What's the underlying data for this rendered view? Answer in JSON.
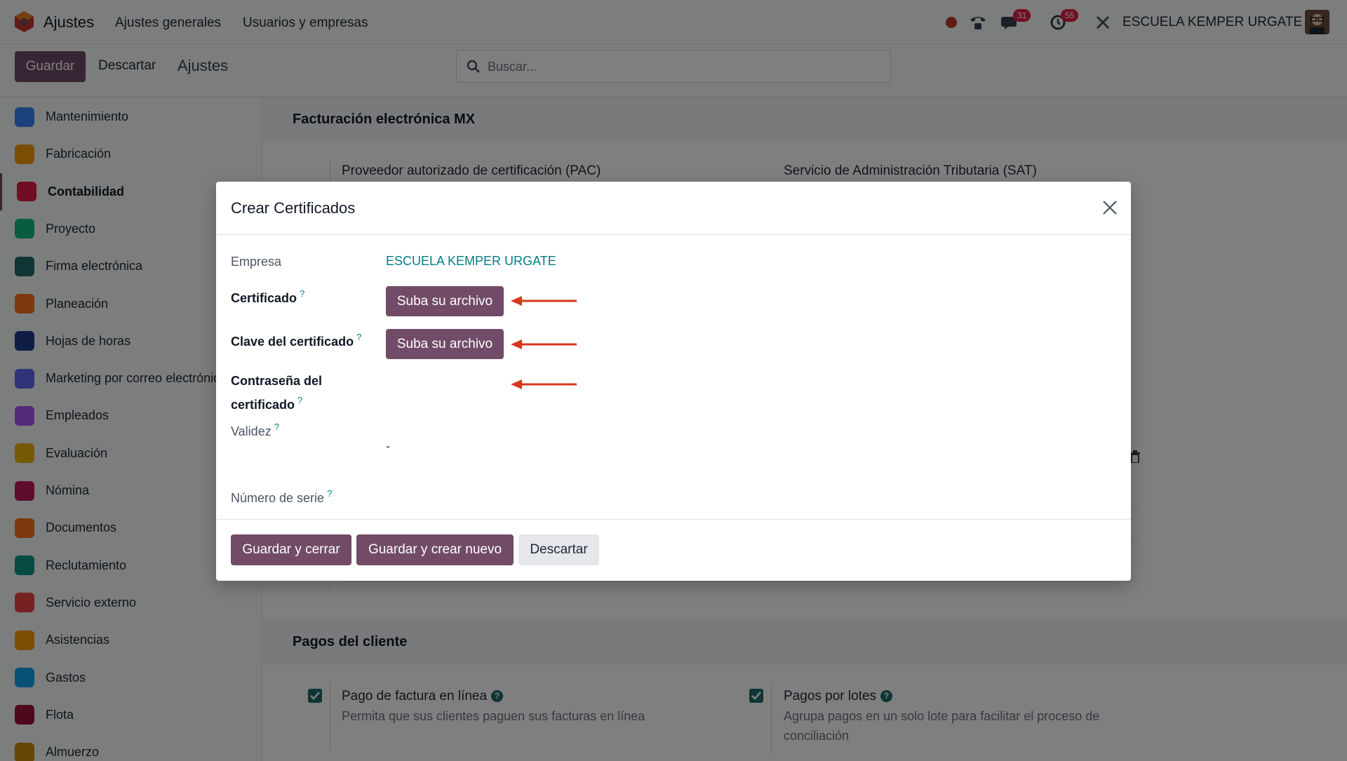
{
  "navbar": {
    "app_name": "Ajustes",
    "menu": [
      "Ajustes generales",
      "Usuarios y empresas"
    ],
    "chat_count": "31",
    "activity_count": "55",
    "company": "ESCUELA KEMPER URGATE"
  },
  "control_panel": {
    "save_label": "Guardar",
    "discard_label": "Descartar",
    "title": "Ajustes",
    "search_placeholder": "Buscar..."
  },
  "sidebar": {
    "items": [
      {
        "label": "Mantenimiento",
        "icon": "maintenance-icon",
        "color": "#3b82f6"
      },
      {
        "label": "Fabricación",
        "icon": "manufacturing-icon",
        "color": "#f59e0b"
      },
      {
        "label": "Contabilidad",
        "icon": "accounting-icon",
        "color": "#e11d48",
        "active": true
      },
      {
        "label": "Proyecto",
        "icon": "project-icon",
        "color": "#10b981"
      },
      {
        "label": "Firma electrónica",
        "icon": "signature-icon",
        "color": "#1e6a6b"
      },
      {
        "label": "Planeación",
        "icon": "planning-icon",
        "color": "#f97316"
      },
      {
        "label": "Hojas de horas",
        "icon": "timesheet-icon",
        "color": "#1e3a8a"
      },
      {
        "label": "Marketing por correo electrónico",
        "icon": "email-marketing-icon",
        "color": "#6366f1"
      },
      {
        "label": "Empleados",
        "icon": "employees-icon",
        "color": "#a855f7"
      },
      {
        "label": "Evaluación",
        "icon": "appraisal-icon",
        "color": "#eab308"
      },
      {
        "label": "Nómina",
        "icon": "payroll-icon",
        "color": "#be185d"
      },
      {
        "label": "Documentos",
        "icon": "documents-icon",
        "color": "#f97316"
      },
      {
        "label": "Reclutamiento",
        "icon": "recruitment-icon",
        "color": "#0d9488"
      },
      {
        "label": "Servicio externo",
        "icon": "field-service-icon",
        "color": "#ef4444"
      },
      {
        "label": "Asistencias",
        "icon": "attendances-icon",
        "color": "#f59e0b"
      },
      {
        "label": "Gastos",
        "icon": "expenses-icon",
        "color": "#0ea5e9"
      },
      {
        "label": "Flota",
        "icon": "fleet-icon",
        "color": "#9f1239"
      },
      {
        "label": "Almuerzo",
        "icon": "lunch-icon",
        "color": "#ca8a04"
      }
    ]
  },
  "main": {
    "section1_title": "Facturación electrónica MX",
    "pac_title": "Proveedor autorizado de certificación (PAC)",
    "sat_title": "Servicio de Administración Tributaria (SAT)",
    "section2_title": "Pagos del cliente",
    "online_payment_title": "Pago de factura en línea",
    "online_payment_desc": "Permita que sus clientes paguen sus facturas en línea",
    "batch_payment_title": "Pagos por lotes",
    "batch_payment_desc": "Agrupa pagos en un solo lote para facilitar el proceso de conciliación"
  },
  "modal": {
    "title": "Crear Certificados",
    "company_label": "Empresa",
    "company_value": "ESCUELA KEMPER URGATE",
    "certificate_label": "Certificado",
    "key_label": "Clave del certificado",
    "password_label_1": "Contraseña del",
    "password_label_2": "certificado",
    "upload_label": "Suba su archivo",
    "validity_label": "Validez",
    "validity_value": "-",
    "serial_label": "Número de serie",
    "help_mark": "?",
    "save_close": "Guardar y cerrar",
    "save_new": "Guardar y crear nuevo",
    "discard": "Descartar"
  },
  "colors": {
    "primary": "#714b67",
    "teal": "#017e84",
    "arrow": "#d9361e"
  }
}
